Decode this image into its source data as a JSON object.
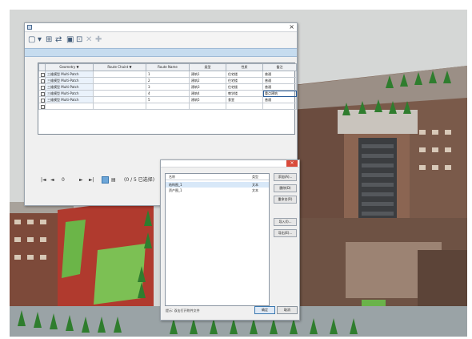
{
  "table_window": {
    "title": "",
    "close_glyph": "×",
    "toolbar_icons": [
      "table-icon",
      "options-dropdown-icon",
      "select-by-attributes-icon",
      "switch-selection-icon",
      "clear-selection-icon",
      "zoom-to-selected-icon",
      "delete-selected-icon",
      "add-field-icon"
    ],
    "tab_label": "",
    "columns": [
      "",
      "Geometry ▼",
      "Route Chaint ▼",
      "Route Name",
      "类型",
      "性质",
      "备注"
    ],
    "rows": [
      {
        "c1": "三维模型 Multi-Patch",
        "c2": "",
        "c3": "1",
        "c4": "建筑1",
        "c5": "住宅楼",
        "c6": "普通"
      },
      {
        "c1": "三维模型 Multi-Patch",
        "c2": "",
        "c3": "2",
        "c4": "建筑2",
        "c5": "住宅楼",
        "c6": "普通"
      },
      {
        "c1": "三维模型 Multi-Patch",
        "c2": "",
        "c3": "3",
        "c4": "建筑3",
        "c5": "住宅楼",
        "c6": "普通"
      },
      {
        "c1": "三维模型 Multi-Patch",
        "c2": "",
        "c3": "4",
        "c4": "建筑4",
        "c5": "教学楼",
        "c6": "重点建筑"
      },
      {
        "c1": "三维模型 Multi-Patch",
        "c2": "",
        "c3": "5",
        "c4": "建筑5",
        "c5": "食堂",
        "c6": "普通"
      },
      {
        "c1": "",
        "c2": "",
        "c3": "",
        "c4": "",
        "c5": "",
        "c6": ""
      }
    ],
    "nav": {
      "first": "|◄",
      "prev": "◄",
      "next": "►",
      "last": "►|",
      "position": "0",
      "label": "(0 / 5 已选择)"
    },
    "status_text": ""
  },
  "dialog": {
    "title": "",
    "close_glyph": "×",
    "list_headers": [
      "名称",
      "类型"
    ],
    "list_items": [
      {
        "name": "结构图_1",
        "kind": "文本",
        "selected": true
      },
      {
        "name": "资产图_1",
        "kind": "文本",
        "selected": false
      }
    ],
    "side_buttons": [
      "添加(A)...",
      "删除(D)",
      "重命名(R)",
      "导入(I)...",
      "导出(E)..."
    ],
    "footer_text": "提示: 双击打开附件文件",
    "ok_label": "确定",
    "cancel_label": "取消"
  }
}
